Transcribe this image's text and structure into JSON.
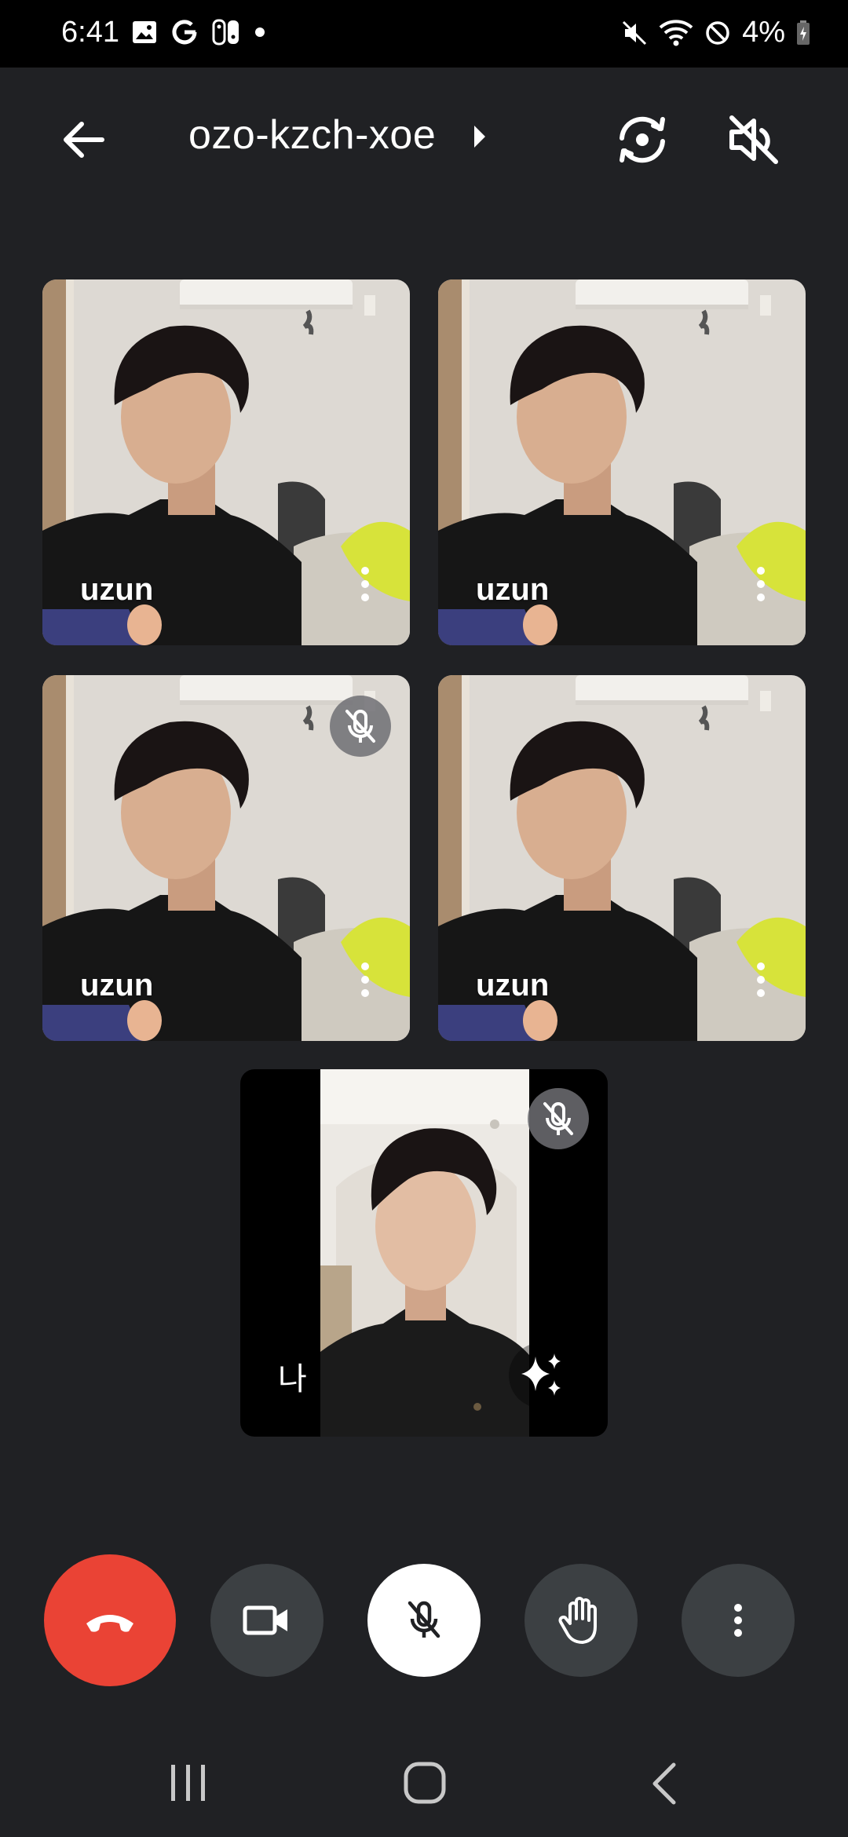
{
  "status_bar": {
    "time": "6:41",
    "battery": "4%",
    "icons": [
      "gallery-icon",
      "google-icon",
      "switch-icon",
      "dot-icon",
      "mute-icon",
      "wifi-icon",
      "do-not-disturb-icon",
      "battery-icon"
    ]
  },
  "header": {
    "meeting_code": "ozo-kzch-xoe",
    "icons": [
      "back-arrow-icon",
      "caret-right-icon",
      "switch-camera-icon",
      "speaker-off-icon"
    ]
  },
  "participants": [
    {
      "name": "uzun",
      "muted": false
    },
    {
      "name": "uzun",
      "muted": false
    },
    {
      "name": "uzun",
      "muted": true
    },
    {
      "name": "uzun",
      "muted": false
    }
  ],
  "self_tile": {
    "label": "나",
    "muted": true,
    "effects_icon": "sparkles-icon"
  },
  "controls": {
    "end_call_color": "#ea4335",
    "icons": [
      "end-call-icon",
      "camera-icon",
      "mic-off-icon",
      "raise-hand-icon",
      "more-vert-icon"
    ]
  },
  "nav_bar": {
    "icons": [
      "recents-icon",
      "home-icon",
      "back-icon"
    ]
  }
}
